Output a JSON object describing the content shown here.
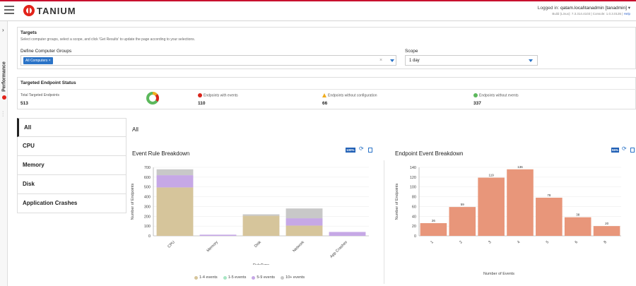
{
  "header": {
    "brand": "TANIUM",
    "login_prefix": "Logged in:",
    "user": "qatam.local\\tanadmin [tanadmin]",
    "build_text": "Build (Linux): 7.3.314.4103 | Console: 1.0.3.0135 |",
    "help": "Help"
  },
  "sidebar": {
    "label": "Performance"
  },
  "targets": {
    "title": "Targets",
    "subtitle": "Select computer groups, select a scope, and click 'Get Results' to update the page according to your selections.",
    "groups_label": "Define Computer Groups",
    "group_chip": "All Computers",
    "scope_label": "Scope",
    "scope_value": "1 day"
  },
  "status": {
    "title": "Targeted Endpoint Status",
    "total_label": "Total Targeted Endpoints",
    "total_value": "513",
    "with_events_label": "Endpoints with events",
    "with_events_value": "110",
    "without_config_label": "Endpoints without configuration",
    "without_config_value": "66",
    "without_events_label": "Endpoints without events",
    "without_events_value": "337",
    "colors": {
      "red": "#d9251c",
      "yellow": "#f0ad1e",
      "green": "#5cb85c"
    }
  },
  "tabs": [
    "All",
    "CPU",
    "Memory",
    "Disk",
    "Application Crashes"
  ],
  "main_title": "All",
  "charts": {
    "left_pct": "100%",
    "right_pct": "55%"
  },
  "chart_data": [
    {
      "type": "bar",
      "title": "Event Rule Breakdown",
      "xlabel": "RuleType",
      "ylabel": "Number of Endpoints",
      "categories": [
        "CPU",
        "Memory",
        "Disk",
        "Network",
        "App Crashes"
      ],
      "series": [
        {
          "name": "1-4 events",
          "color": "#d6c59b",
          "values": [
            495,
            0,
            205,
            105,
            0
          ]
        },
        {
          "name": "1-5 events",
          "color": "#a8e6c4",
          "values": [
            0,
            0,
            0,
            0,
            0
          ]
        },
        {
          "name": "5-9 events",
          "color": "#c6a8e6",
          "values": [
            125,
            12,
            0,
            75,
            40
          ]
        },
        {
          "name": "10+ events",
          "color": "#c8c8c8",
          "values": [
            60,
            0,
            15,
            100,
            0
          ]
        }
      ],
      "ylim": [
        0,
        700
      ],
      "yticks": [
        0,
        100,
        200,
        300,
        400,
        500,
        600,
        700
      ],
      "legend": "bottom"
    },
    {
      "type": "bar",
      "title": "Endpoint Event Breakdown",
      "xlabel": "Number of Events",
      "ylabel": "Number of Endpoints",
      "categories": [
        "1",
        "2",
        "3",
        "4",
        "5",
        "6",
        "8"
      ],
      "values": [
        26,
        59,
        119,
        136,
        78,
        38,
        20
      ],
      "color": "#e8967a",
      "ylim": [
        0,
        140
      ],
      "yticks": [
        0,
        20,
        40,
        60,
        80,
        100,
        120,
        140
      ]
    }
  ]
}
